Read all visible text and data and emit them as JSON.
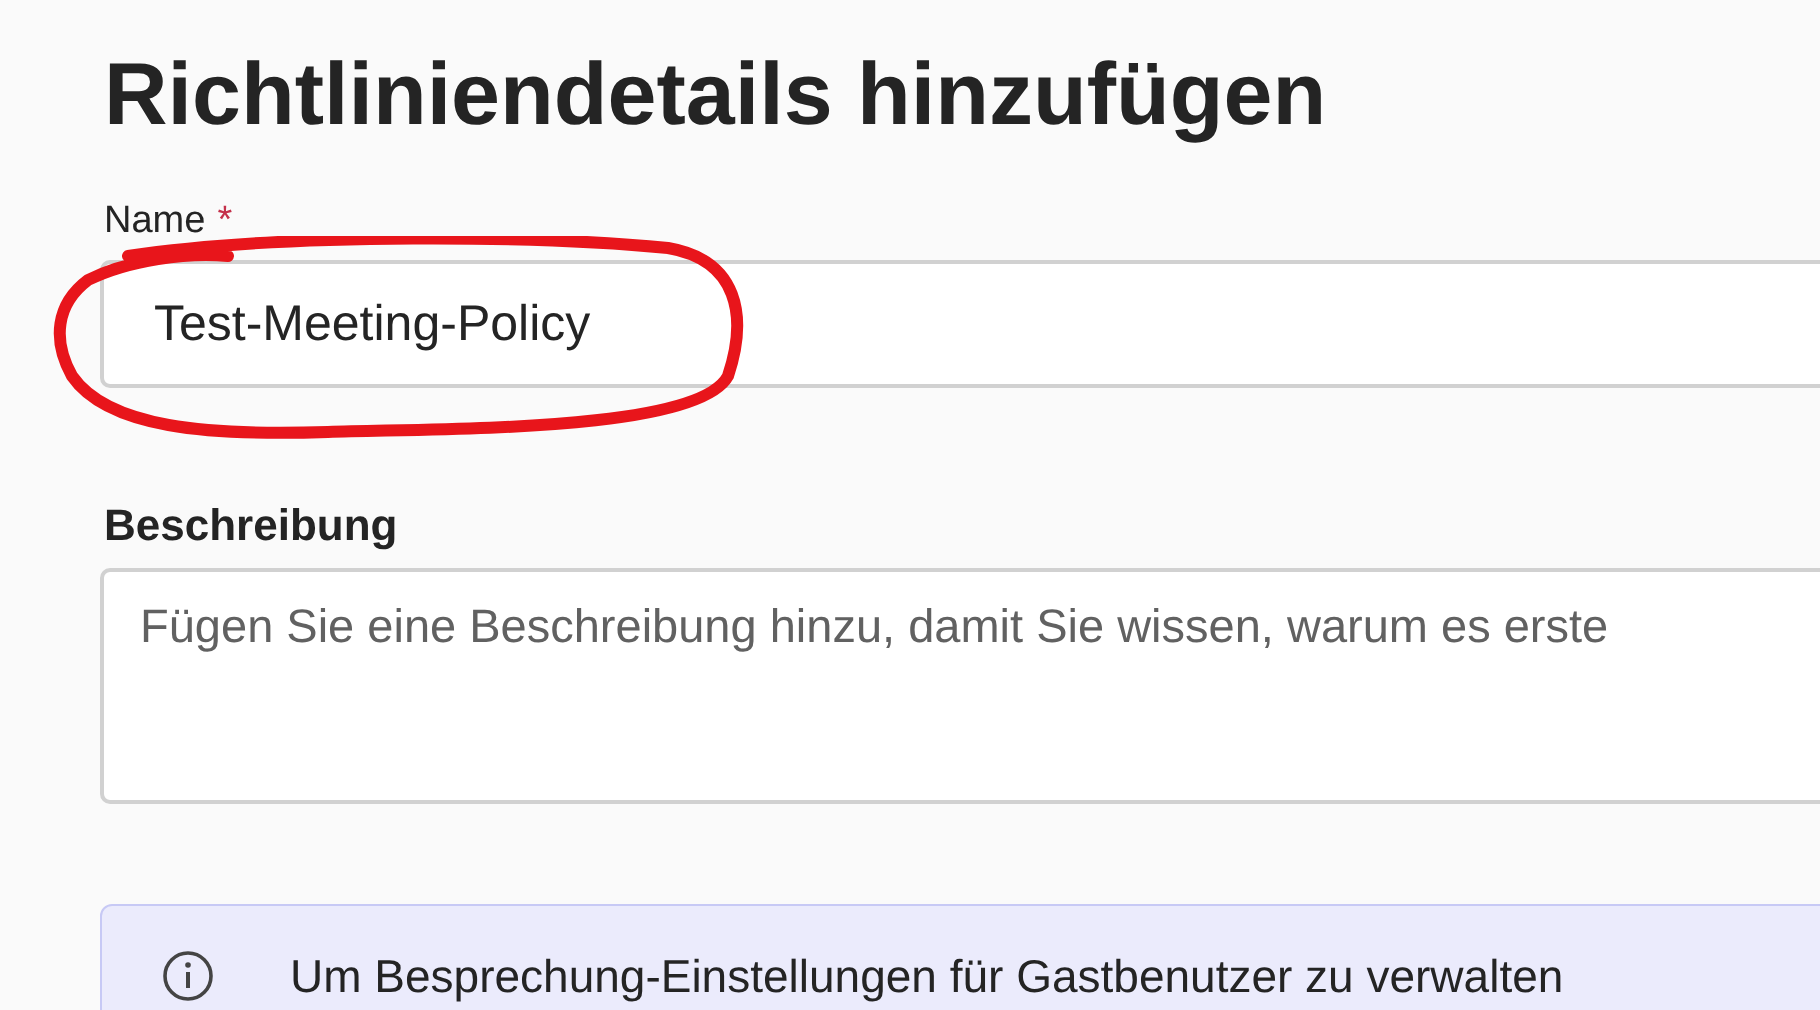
{
  "title": "Richtliniendetails hinzufügen",
  "name_field": {
    "label": "Name",
    "required": true,
    "required_mark": "*",
    "value": "Test-Meeting-Policy",
    "highlighted": true
  },
  "description_field": {
    "label": "Beschreibung",
    "placeholder": "Fügen Sie eine Beschreibung hinzu, damit Sie wissen, warum es erste"
  },
  "info_banner": {
    "text": "Um Besprechung-Einstellungen für Gastbenutzer zu verwalten"
  }
}
